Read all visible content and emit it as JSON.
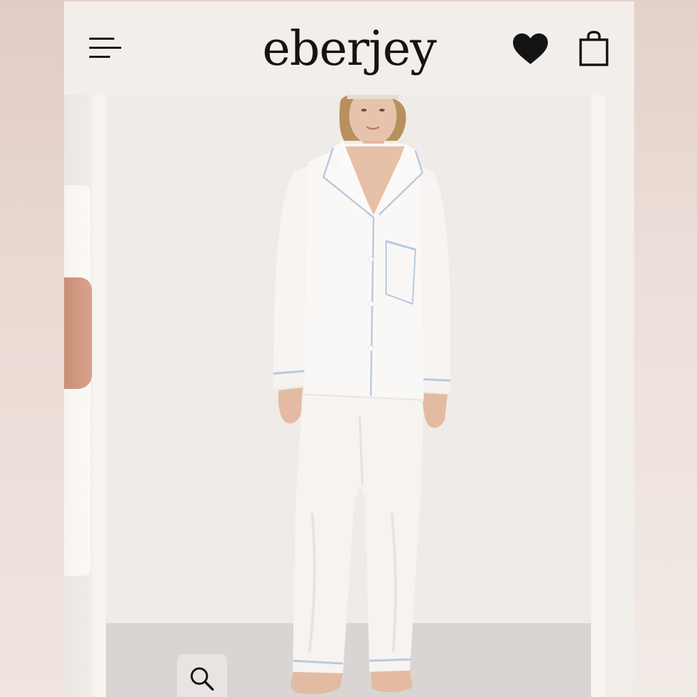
{
  "header": {
    "brand": "eberjey",
    "icons": {
      "menu": "menu-icon",
      "wishlist": "heart-icon",
      "bag": "shopping-bag-icon"
    }
  },
  "gallery": {
    "main_image": "model-in-white-pajama-set",
    "zoom_icon": "magnifier-icon"
  },
  "colors": {
    "background": "#f4efea",
    "text": "#141414",
    "piping": "#b9c9e0"
  }
}
